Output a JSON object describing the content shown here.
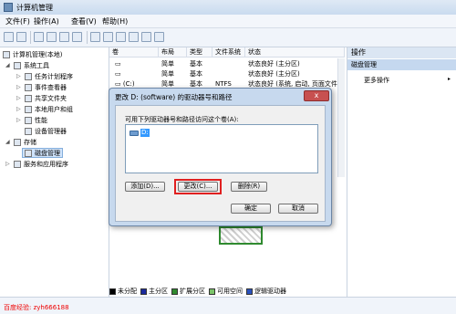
{
  "window": {
    "title": "计算机管理"
  },
  "menu": [
    "文件(F)",
    "操作(A)",
    "查看(V)",
    "帮助(H)"
  ],
  "tree": {
    "root": "计算机管理(本地)",
    "items": [
      {
        "label": "系统工具",
        "level": 1,
        "twisty": "◢"
      },
      {
        "label": "任务计划程序",
        "level": 2,
        "twisty": "▷"
      },
      {
        "label": "事件查看器",
        "level": 2,
        "twisty": "▷"
      },
      {
        "label": "共享文件夹",
        "level": 2,
        "twisty": "▷"
      },
      {
        "label": "本地用户和组",
        "level": 2,
        "twisty": "▷"
      },
      {
        "label": "性能",
        "level": 2,
        "twisty": "▷"
      },
      {
        "label": "设备管理器",
        "level": 2,
        "twisty": ""
      },
      {
        "label": "存储",
        "level": 1,
        "twisty": "◢"
      },
      {
        "label": "磁盘管理",
        "level": 2,
        "twisty": "",
        "selected": true
      },
      {
        "label": "服务和应用程序",
        "level": 1,
        "twisty": "▷"
      }
    ]
  },
  "volumes": {
    "columns": [
      "卷",
      "布局",
      "类型",
      "文件系统",
      "状态"
    ],
    "rows": [
      [
        "",
        "简单",
        "基本",
        "",
        "状态良好 (主分区)"
      ],
      [
        "",
        "简单",
        "基本",
        "",
        "状态良好 (主分区)"
      ],
      [
        "(C:)",
        "简单",
        "基本",
        "NTFS",
        "状态良好 (系统, 启动, 页面文件, 活动, 故"
      ],
      [
        "",
        "",
        "",
        "",
        ""
      ]
    ]
  },
  "actions": {
    "header": "操作",
    "section": "磁盘管理",
    "more": "更多操作"
  },
  "legend": [
    "未分配",
    "主分区",
    "扩展分区",
    "可用空间",
    "逻辑驱动器"
  ],
  "legend_colors": [
    "#000000",
    "#1b2a9c",
    "#2f8a2f",
    "#7cc46a",
    "#2a52be"
  ],
  "dialog": {
    "title": "更改 D: (software) 的驱动器号和路径",
    "label": "可用下列驱动器号和路径访问这个卷(A):",
    "list_item": "D:",
    "buttons": {
      "add": "添加(D)...",
      "change": "更改(C)...",
      "remove": "删除(R)",
      "ok": "确定",
      "cancel": "取消"
    },
    "close": "x"
  },
  "status": {
    "text": "百度经验: zyh666188"
  }
}
